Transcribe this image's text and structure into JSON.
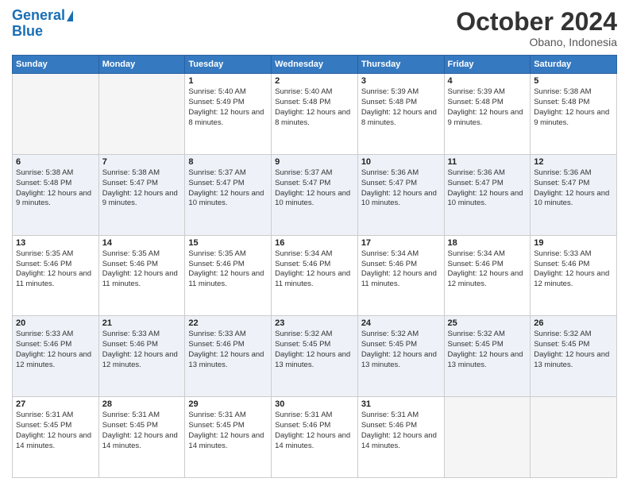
{
  "header": {
    "logo_line1": "General",
    "logo_line2": "Blue",
    "month": "October 2024",
    "location": "Obano, Indonesia"
  },
  "weekdays": [
    "Sunday",
    "Monday",
    "Tuesday",
    "Wednesday",
    "Thursday",
    "Friday",
    "Saturday"
  ],
  "weeks": [
    [
      {
        "day": "",
        "sunrise": "",
        "sunset": "",
        "daylight": ""
      },
      {
        "day": "",
        "sunrise": "",
        "sunset": "",
        "daylight": ""
      },
      {
        "day": "1",
        "sunrise": "Sunrise: 5:40 AM",
        "sunset": "Sunset: 5:49 PM",
        "daylight": "Daylight: 12 hours and 8 minutes."
      },
      {
        "day": "2",
        "sunrise": "Sunrise: 5:40 AM",
        "sunset": "Sunset: 5:48 PM",
        "daylight": "Daylight: 12 hours and 8 minutes."
      },
      {
        "day": "3",
        "sunrise": "Sunrise: 5:39 AM",
        "sunset": "Sunset: 5:48 PM",
        "daylight": "Daylight: 12 hours and 8 minutes."
      },
      {
        "day": "4",
        "sunrise": "Sunrise: 5:39 AM",
        "sunset": "Sunset: 5:48 PM",
        "daylight": "Daylight: 12 hours and 9 minutes."
      },
      {
        "day": "5",
        "sunrise": "Sunrise: 5:38 AM",
        "sunset": "Sunset: 5:48 PM",
        "daylight": "Daylight: 12 hours and 9 minutes."
      }
    ],
    [
      {
        "day": "6",
        "sunrise": "Sunrise: 5:38 AM",
        "sunset": "Sunset: 5:48 PM",
        "daylight": "Daylight: 12 hours and 9 minutes."
      },
      {
        "day": "7",
        "sunrise": "Sunrise: 5:38 AM",
        "sunset": "Sunset: 5:47 PM",
        "daylight": "Daylight: 12 hours and 9 minutes."
      },
      {
        "day": "8",
        "sunrise": "Sunrise: 5:37 AM",
        "sunset": "Sunset: 5:47 PM",
        "daylight": "Daylight: 12 hours and 10 minutes."
      },
      {
        "day": "9",
        "sunrise": "Sunrise: 5:37 AM",
        "sunset": "Sunset: 5:47 PM",
        "daylight": "Daylight: 12 hours and 10 minutes."
      },
      {
        "day": "10",
        "sunrise": "Sunrise: 5:36 AM",
        "sunset": "Sunset: 5:47 PM",
        "daylight": "Daylight: 12 hours and 10 minutes."
      },
      {
        "day": "11",
        "sunrise": "Sunrise: 5:36 AM",
        "sunset": "Sunset: 5:47 PM",
        "daylight": "Daylight: 12 hours and 10 minutes."
      },
      {
        "day": "12",
        "sunrise": "Sunrise: 5:36 AM",
        "sunset": "Sunset: 5:47 PM",
        "daylight": "Daylight: 12 hours and 10 minutes."
      }
    ],
    [
      {
        "day": "13",
        "sunrise": "Sunrise: 5:35 AM",
        "sunset": "Sunset: 5:46 PM",
        "daylight": "Daylight: 12 hours and 11 minutes."
      },
      {
        "day": "14",
        "sunrise": "Sunrise: 5:35 AM",
        "sunset": "Sunset: 5:46 PM",
        "daylight": "Daylight: 12 hours and 11 minutes."
      },
      {
        "day": "15",
        "sunrise": "Sunrise: 5:35 AM",
        "sunset": "Sunset: 5:46 PM",
        "daylight": "Daylight: 12 hours and 11 minutes."
      },
      {
        "day": "16",
        "sunrise": "Sunrise: 5:34 AM",
        "sunset": "Sunset: 5:46 PM",
        "daylight": "Daylight: 12 hours and 11 minutes."
      },
      {
        "day": "17",
        "sunrise": "Sunrise: 5:34 AM",
        "sunset": "Sunset: 5:46 PM",
        "daylight": "Daylight: 12 hours and 11 minutes."
      },
      {
        "day": "18",
        "sunrise": "Sunrise: 5:34 AM",
        "sunset": "Sunset: 5:46 PM",
        "daylight": "Daylight: 12 hours and 12 minutes."
      },
      {
        "day": "19",
        "sunrise": "Sunrise: 5:33 AM",
        "sunset": "Sunset: 5:46 PM",
        "daylight": "Daylight: 12 hours and 12 minutes."
      }
    ],
    [
      {
        "day": "20",
        "sunrise": "Sunrise: 5:33 AM",
        "sunset": "Sunset: 5:46 PM",
        "daylight": "Daylight: 12 hours and 12 minutes."
      },
      {
        "day": "21",
        "sunrise": "Sunrise: 5:33 AM",
        "sunset": "Sunset: 5:46 PM",
        "daylight": "Daylight: 12 hours and 12 minutes."
      },
      {
        "day": "22",
        "sunrise": "Sunrise: 5:33 AM",
        "sunset": "Sunset: 5:46 PM",
        "daylight": "Daylight: 12 hours and 13 minutes."
      },
      {
        "day": "23",
        "sunrise": "Sunrise: 5:32 AM",
        "sunset": "Sunset: 5:45 PM",
        "daylight": "Daylight: 12 hours and 13 minutes."
      },
      {
        "day": "24",
        "sunrise": "Sunrise: 5:32 AM",
        "sunset": "Sunset: 5:45 PM",
        "daylight": "Daylight: 12 hours and 13 minutes."
      },
      {
        "day": "25",
        "sunrise": "Sunrise: 5:32 AM",
        "sunset": "Sunset: 5:45 PM",
        "daylight": "Daylight: 12 hours and 13 minutes."
      },
      {
        "day": "26",
        "sunrise": "Sunrise: 5:32 AM",
        "sunset": "Sunset: 5:45 PM",
        "daylight": "Daylight: 12 hours and 13 minutes."
      }
    ],
    [
      {
        "day": "27",
        "sunrise": "Sunrise: 5:31 AM",
        "sunset": "Sunset: 5:45 PM",
        "daylight": "Daylight: 12 hours and 14 minutes."
      },
      {
        "day": "28",
        "sunrise": "Sunrise: 5:31 AM",
        "sunset": "Sunset: 5:45 PM",
        "daylight": "Daylight: 12 hours and 14 minutes."
      },
      {
        "day": "29",
        "sunrise": "Sunrise: 5:31 AM",
        "sunset": "Sunset: 5:45 PM",
        "daylight": "Daylight: 12 hours and 14 minutes."
      },
      {
        "day": "30",
        "sunrise": "Sunrise: 5:31 AM",
        "sunset": "Sunset: 5:46 PM",
        "daylight": "Daylight: 12 hours and 14 minutes."
      },
      {
        "day": "31",
        "sunrise": "Sunrise: 5:31 AM",
        "sunset": "Sunset: 5:46 PM",
        "daylight": "Daylight: 12 hours and 14 minutes."
      },
      {
        "day": "",
        "sunrise": "",
        "sunset": "",
        "daylight": ""
      },
      {
        "day": "",
        "sunrise": "",
        "sunset": "",
        "daylight": ""
      }
    ]
  ]
}
